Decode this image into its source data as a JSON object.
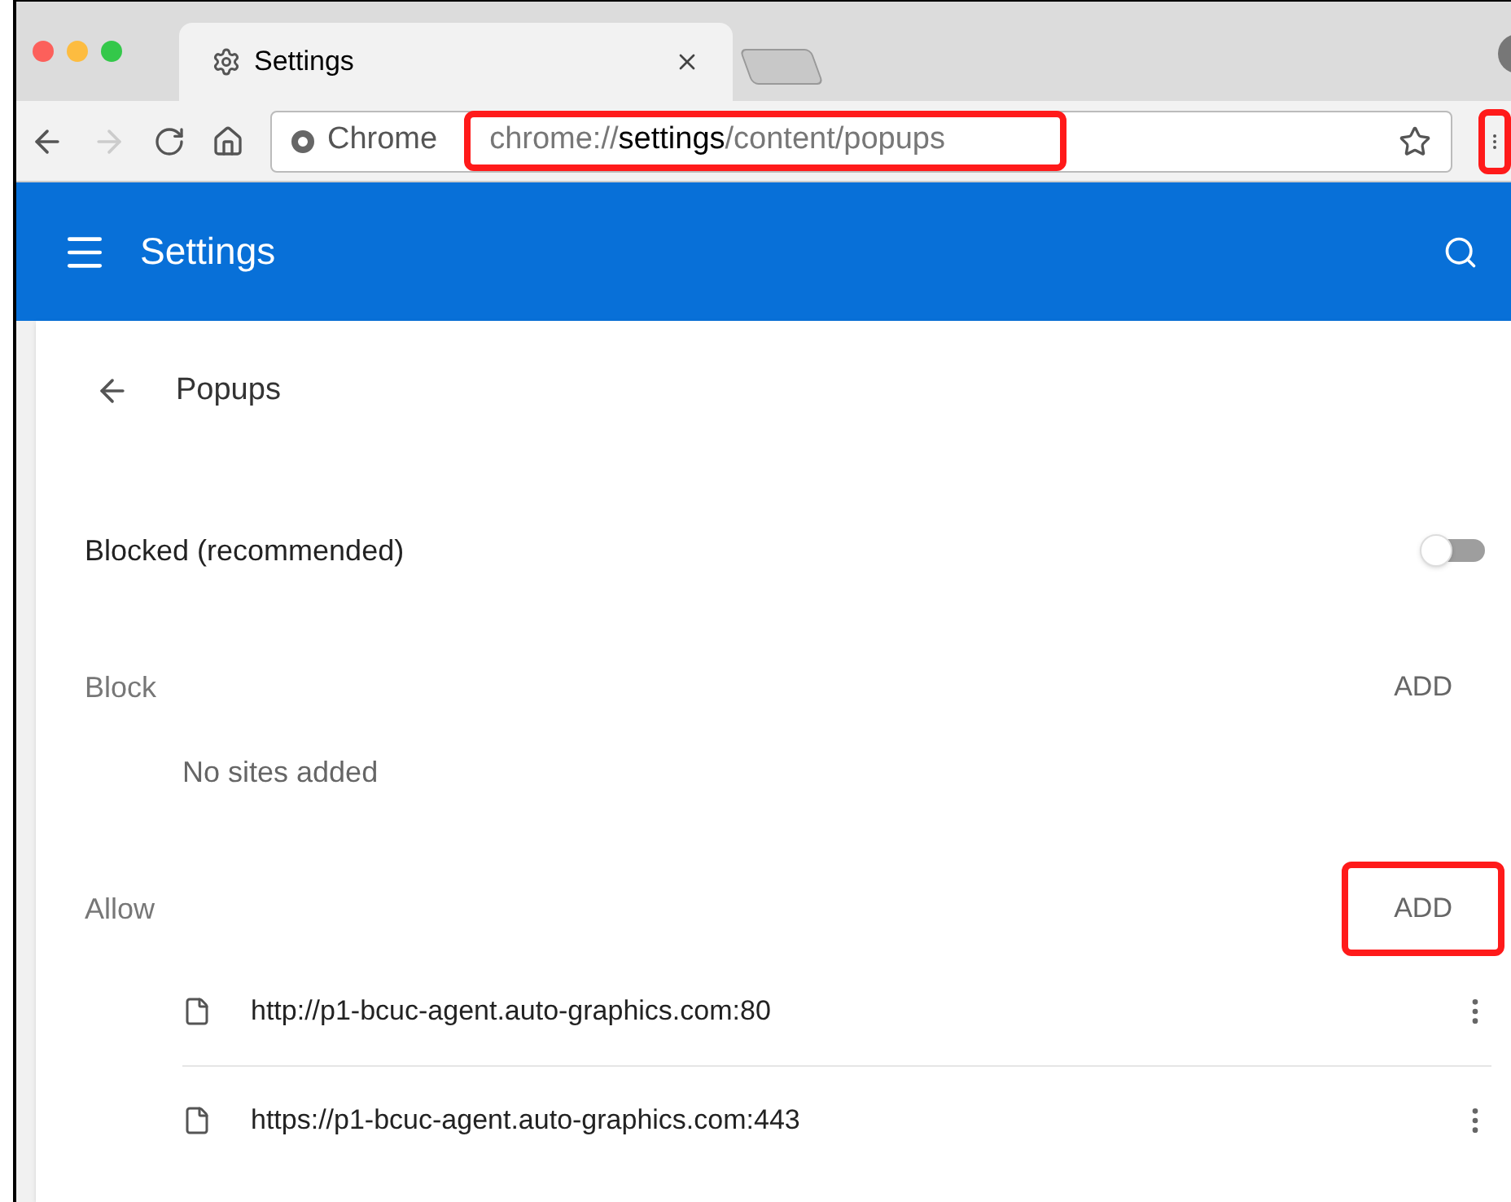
{
  "tab": {
    "title": "Settings",
    "selected": true
  },
  "toolbar": {
    "forward_disabled": true,
    "omnibox": {
      "chip": "Chrome",
      "url": "chrome://**settings**/content/popups",
      "highlighted": true
    },
    "menu_highlighted": true
  },
  "header": {
    "title": "Settings"
  },
  "page": {
    "title": "Popups",
    "toggle": {
      "label": "Blocked (recommended)",
      "on": false
    },
    "sections": [
      {
        "title": "Block",
        "add": {
          "label": "ADD",
          "highlighted": false
        },
        "empty": "No sites added"
      },
      {
        "title": "Allow",
        "add": {
          "label": "ADD",
          "highlighted": true
        },
        "sites": [
          "http://p1-bcuc-agent.auto-graphics.com:80",
          "https://p1-bcuc-agent.auto-graphics.com:443"
        ]
      }
    ]
  }
}
